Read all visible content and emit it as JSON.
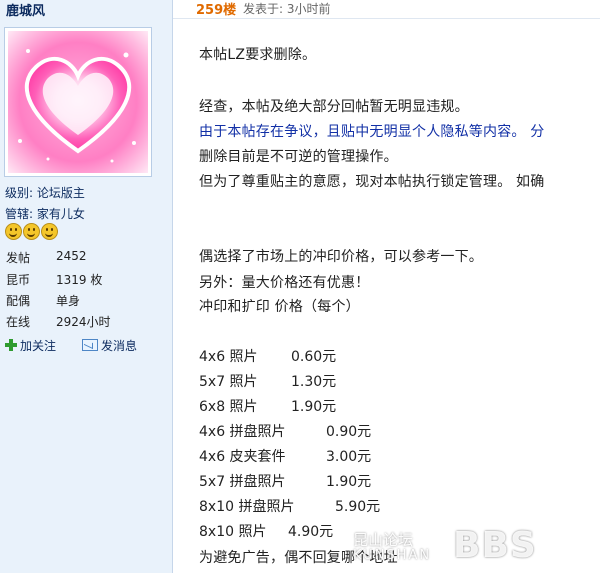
{
  "user": {
    "name": "鹿城风",
    "level_label": "级别: 论坛版主",
    "manage_label": "管辖: 家有儿女",
    "stats": [
      {
        "key": "发帖",
        "value": "2452"
      },
      {
        "key": "昆币",
        "value": "1319 枚"
      },
      {
        "key": "配偶",
        "value": "单身"
      },
      {
        "key": "在线",
        "value": "2924小时"
      }
    ],
    "follow_label": "加关注",
    "message_label": "发消息"
  },
  "post": {
    "floor": "259楼",
    "posted": "发表于: 3小时前",
    "notice": [
      "本帖LZ要求删除。",
      "经查，本帖及绝大部分回帖暂无明显违规。",
      "由于本帖存在争议，且贴中无明显个人隐私等内容。 分",
      "删除目前是不可逆的管理操作。",
      "但为了尊重贴主的意愿，现对本帖执行锁定管理。 如确"
    ],
    "intro": [
      "偶选择了市场上的冲印价格，可以参考一下。",
      "另外：量大价格还有优惠！",
      "冲印和扩印 价格（每个）"
    ],
    "prices": [
      {
        "name": "4x6 照片",
        "price": "0.60元"
      },
      {
        "name": "5x7 照片",
        "price": "1.30元"
      },
      {
        "name": "6x8 照片",
        "price": "1.90元"
      },
      {
        "name": "4x6 拼盘照片",
        "price": "0.90元"
      },
      {
        "name": "4x6 皮夹套件",
        "price": "3.00元"
      },
      {
        "name": "5x7 拼盘照片",
        "price": "1.90元"
      },
      {
        "name": "8x10 拼盘照片",
        "price": "5.90元"
      },
      {
        "name": "8x10 照片",
        "price": "4.90元"
      }
    ],
    "cut_line": "为避免广告，偶不回复哪个地址"
  },
  "watermark": {
    "cn": "昆山论坛",
    "en": "KUNSHAN",
    "big": "BBS"
  },
  "colors": {
    "floor": "#e06a00",
    "notice_blue": "#1230a6",
    "sidebar_bg": "#e9f2fb"
  }
}
